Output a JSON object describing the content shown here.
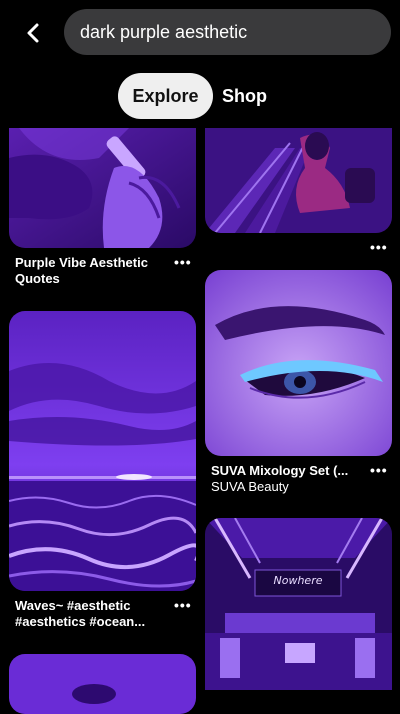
{
  "search": {
    "value": "dark purple aesthetic"
  },
  "tabs": {
    "explore": "Explore",
    "shop": "Shop"
  },
  "pins": {
    "left": [
      {
        "title": "Purple Vibe Aesthetic Quotes"
      },
      {
        "title": "Waves~ #aesthetic #aesthetics #ocean..."
      }
    ],
    "right": [
      {
        "title": ""
      },
      {
        "title": "SUVA Mixology Set (...",
        "subtitle": "SUVA Beauty"
      },
      {
        "sign": "Nowhere"
      }
    ]
  },
  "more_glyph": "•••",
  "colors": {
    "background": "#000000",
    "search_bg": "#3a3a3c",
    "accent_purple": "#6a2cc7",
    "liner_blue": "#6ec8ff"
  },
  "icons": [
    "chevron-left-icon",
    "more-icon"
  ]
}
